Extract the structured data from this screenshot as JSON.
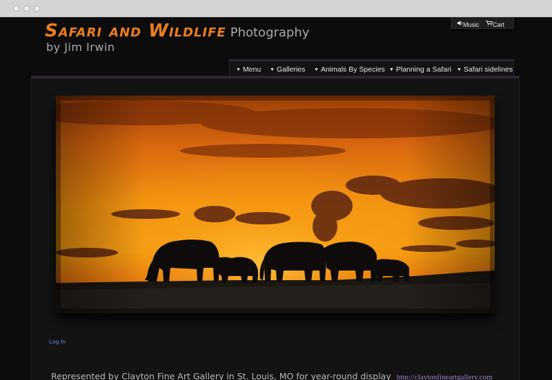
{
  "browser": {
    "dots": [
      "close",
      "minimize",
      "maximize"
    ]
  },
  "header": {
    "title_main": "Safari and Wildlife",
    "title_sub": "Photography",
    "byline": "by Jim Irwin"
  },
  "utility": {
    "music_icon": "speaker-icon",
    "music_label": "Music",
    "cart_icon": "cart-icon",
    "cart_label": "Cart"
  },
  "nav": {
    "items": [
      {
        "label": "Menu"
      },
      {
        "label": "Galleries"
      },
      {
        "label": "Animals By Species"
      },
      {
        "label": "Planning a Safari"
      },
      {
        "label": "Safari sidelines"
      }
    ]
  },
  "hero": {
    "subject": "elephant herd silhouetted against orange sunset sky"
  },
  "login": {
    "label": "Log In"
  },
  "footer": {
    "text": "Represented by Clayton Fine Art Gallery in St. Louis, MO for year-round display",
    "link": "http://claytonfineartgallery.com"
  },
  "colors": {
    "title": "#ee7d1c",
    "nav_accent": "#2e2637",
    "link": "#a47ccd",
    "login": "#4f6bb4",
    "background": "#0c0c0c"
  }
}
